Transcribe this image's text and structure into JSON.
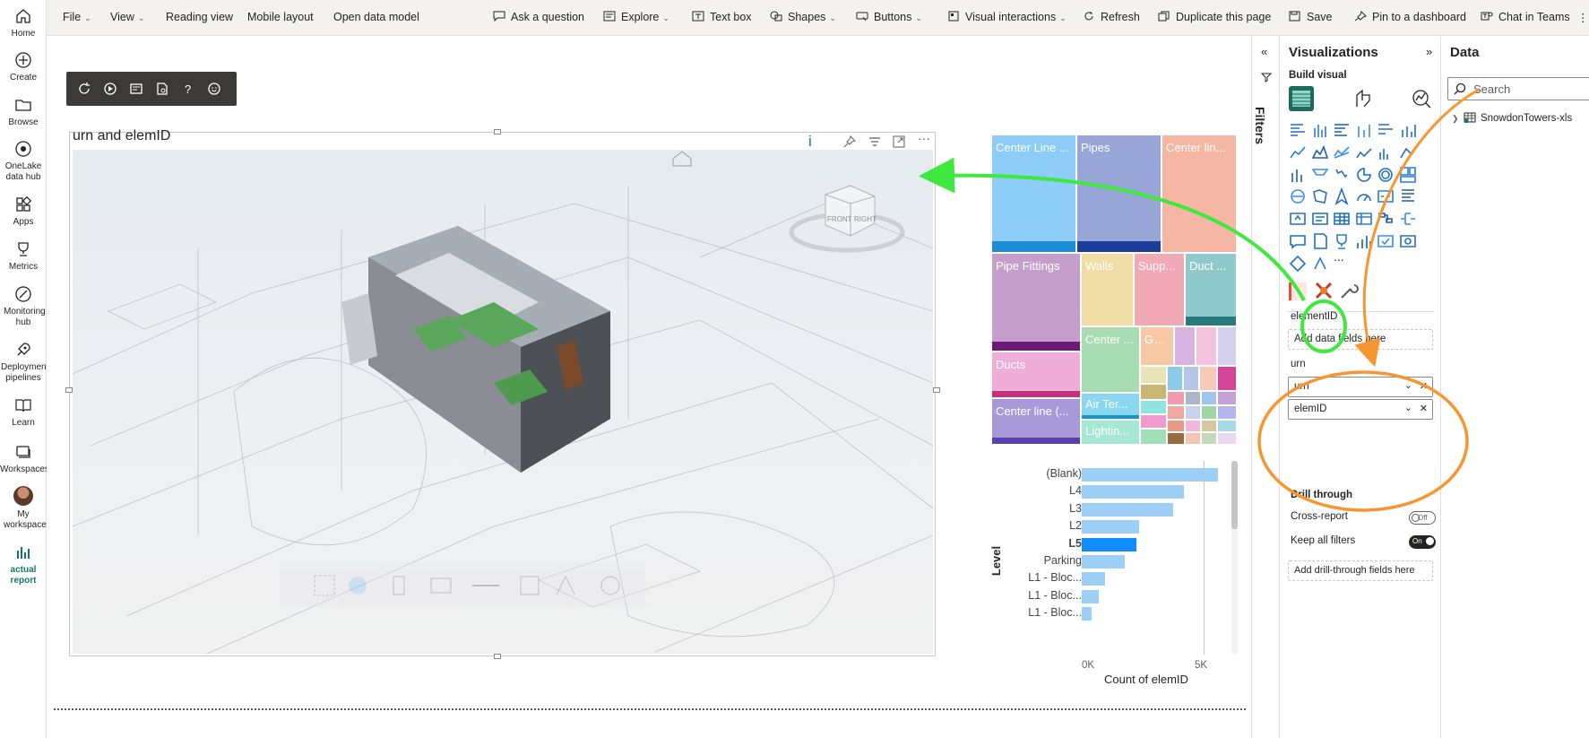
{
  "nav": {
    "items": [
      {
        "label": "Home",
        "icon": "home-icon"
      },
      {
        "label": "Create",
        "icon": "create-icon"
      },
      {
        "label": "Browse",
        "icon": "browse-icon"
      },
      {
        "label": "OneLake data hub",
        "icon": "onelake-icon"
      },
      {
        "label": "Apps",
        "icon": "apps-icon"
      },
      {
        "label": "Metrics",
        "icon": "metrics-icon"
      },
      {
        "label": "Monitoring hub",
        "icon": "monitoring-icon"
      },
      {
        "label": "Deployment pipelines",
        "icon": "deployment-icon"
      },
      {
        "label": "Learn",
        "icon": "learn-icon"
      },
      {
        "label": "Workspaces",
        "icon": "workspaces-icon"
      },
      {
        "label": "My workspace",
        "icon": "avatar"
      },
      {
        "label": "actual report",
        "icon": "report-icon"
      }
    ]
  },
  "ribbon": {
    "file": "File",
    "view": "View",
    "reading_view": "Reading view",
    "mobile_layout": "Mobile layout",
    "open_data_model": "Open data model",
    "ask_question": "Ask a question",
    "explore": "Explore",
    "text_box": "Text box",
    "shapes": "Shapes",
    "buttons": "Buttons",
    "visual_interactions": "Visual interactions",
    "refresh": "Refresh",
    "duplicate_page": "Duplicate this page",
    "save": "Save",
    "pin_dashboard": "Pin to a dashboard",
    "chat_teams": "Chat in Teams"
  },
  "visual": {
    "title": "urn and elemID",
    "info_glyph": "i"
  },
  "treemap": {
    "tiles": [
      {
        "label": "Center Line ...",
        "color": "#8ecdf7",
        "bar": "#1a8cd8"
      },
      {
        "label": "Pipes",
        "color": "#98a6d7",
        "bar": "#1a3c9a"
      },
      {
        "label": "Center lin...",
        "color": "#f5b7a4",
        "bar": "#f5b7a4"
      },
      {
        "label": "Pipe Fittings",
        "color": "#c59fcb",
        "bar": "#6a1b77"
      },
      {
        "label": "Walls",
        "color": "#f0dda6",
        "bar": "#f0dda6"
      },
      {
        "label": "Supp...",
        "color": "#f1a9b5",
        "bar": "#f1a9b5"
      },
      {
        "label": "Duct ...",
        "color": "#90c9cb",
        "bar": "#2a7b80"
      },
      {
        "label": "Ducts",
        "color": "#efaed8",
        "bar": "#c3317c"
      },
      {
        "label": "Center ...",
        "color": "#a8dcb2",
        "bar": "#a8dcb2"
      },
      {
        "label": "Ge...",
        "color": "#f7c8a3",
        "bar": "#f7c8a3"
      },
      {
        "label": "Center line (...",
        "color": "#a79ad8",
        "bar": "#5a3fb0"
      },
      {
        "label": "Air Ter...",
        "color": "#8ad6ef",
        "bar": "#1696c4"
      },
      {
        "label": "Lightin...",
        "color": "#a6e7d3",
        "bar": "#a6e7d3"
      }
    ]
  },
  "chart_data": {
    "type": "bar",
    "orientation": "horizontal",
    "categories": [
      "(Blank)",
      "L4",
      "L3",
      "L2",
      "L5",
      "Parking",
      "L1 - Bloc...",
      "L1 - Bloc...",
      "L1 - Bloc..."
    ],
    "values": [
      5600,
      4200,
      3750,
      2350,
      2250,
      1750,
      950,
      700,
      400
    ],
    "highlighted": "L5",
    "xlabel": "Count of elemID",
    "ylabel": "Level",
    "xticks": [
      "0K",
      "5K"
    ],
    "xlim": [
      0,
      6200
    ],
    "colors": {
      "default": "#9dcef5",
      "highlight": "#118dff"
    }
  },
  "filters": {
    "label": "Filters"
  },
  "viz": {
    "title": "Visualizations",
    "build_visual": "Build visual",
    "more": "...",
    "wells": [
      {
        "label": "elementID",
        "placeholder": "Add data fields here"
      },
      {
        "label": "urn",
        "fields": [
          "urn",
          "elemID"
        ]
      }
    ],
    "drill_through": "Drill through",
    "cross_report": "Cross-report",
    "cross_report_state": "Off",
    "keep_filters": "Keep all filters",
    "keep_filters_state": "On",
    "add_drill": "Add drill-through fields here"
  },
  "data": {
    "title": "Data",
    "search_placeholder": "Search",
    "tables": [
      {
        "name": "SnowdonTowers-xls"
      }
    ]
  },
  "colors": {
    "accent": "#117865",
    "green_annotation": "#3ee83e",
    "orange_annotation": "#f79530",
    "highlight_bar": "#118dff"
  }
}
